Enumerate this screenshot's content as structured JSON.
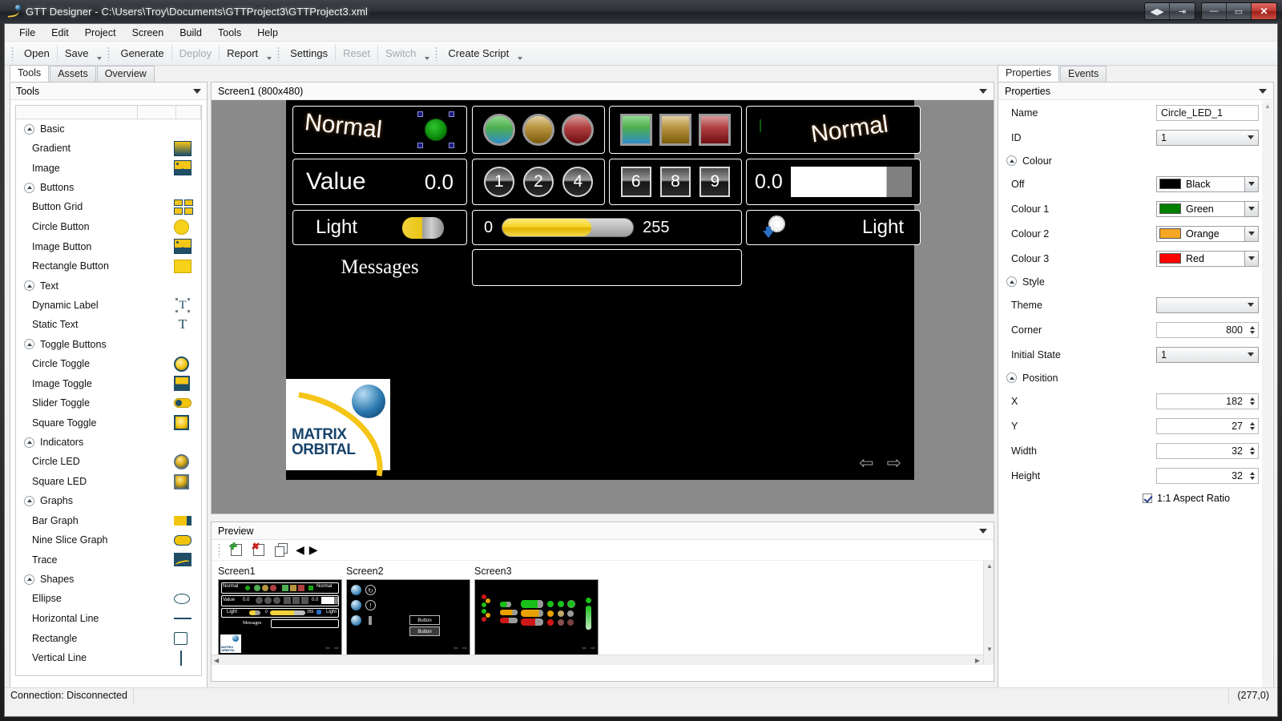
{
  "window": {
    "title": "GTT Designer - C:\\Users\\Troy\\Documents\\GTTProject3\\GTTProject3.xml",
    "buttons": {
      "split": "◀▶",
      "logout": "⇥",
      "minimize": "—",
      "maximize": "▭",
      "close": "✕"
    }
  },
  "menu": [
    "File",
    "Edit",
    "Project",
    "Screen",
    "Build",
    "Tools",
    "Help"
  ],
  "toolbar": {
    "groups": [
      {
        "items": [
          {
            "label": "Open",
            "enabled": true
          },
          {
            "label": "Save",
            "enabled": true
          }
        ]
      },
      {
        "items": [
          {
            "label": "Generate",
            "enabled": true
          },
          {
            "label": "Deploy",
            "enabled": false
          },
          {
            "label": "Report",
            "enabled": true
          }
        ]
      },
      {
        "items": [
          {
            "label": "Settings",
            "enabled": true
          },
          {
            "label": "Reset",
            "enabled": false
          },
          {
            "label": "Switch",
            "enabled": false
          }
        ]
      },
      {
        "items": [
          {
            "label": "Create Script",
            "enabled": true
          }
        ]
      }
    ]
  },
  "left_panel": {
    "tabs": [
      {
        "label": "Tools",
        "active": true
      },
      {
        "label": "Assets",
        "active": false
      },
      {
        "label": "Overview",
        "active": false
      }
    ],
    "header": "Tools",
    "groups": [
      {
        "name": "Basic",
        "items": [
          {
            "label": "Gradient",
            "icon": "gradient-icon"
          },
          {
            "label": "Image",
            "icon": "image-icon"
          }
        ]
      },
      {
        "name": "Buttons",
        "items": [
          {
            "label": "Button Grid",
            "icon": "button-grid-icon"
          },
          {
            "label": "Circle Button",
            "icon": "circle-button-icon"
          },
          {
            "label": "Image Button",
            "icon": "image-button-icon"
          },
          {
            "label": "Rectangle Button",
            "icon": "rectangle-button-icon"
          }
        ]
      },
      {
        "name": "Text",
        "items": [
          {
            "label": "Dynamic Label",
            "icon": "dynamic-label-icon"
          },
          {
            "label": "Static Text",
            "icon": "static-text-icon"
          }
        ]
      },
      {
        "name": "Toggle Buttons",
        "items": [
          {
            "label": "Circle Toggle",
            "icon": "circle-toggle-icon"
          },
          {
            "label": "Image Toggle",
            "icon": "image-toggle-icon"
          },
          {
            "label": "Slider Toggle",
            "icon": "slider-toggle-icon"
          },
          {
            "label": "Square Toggle",
            "icon": "square-toggle-icon"
          }
        ]
      },
      {
        "name": "Indicators",
        "items": [
          {
            "label": "Circle LED",
            "icon": "circle-led-icon"
          },
          {
            "label": "Square LED",
            "icon": "square-led-icon"
          }
        ]
      },
      {
        "name": "Graphs",
        "items": [
          {
            "label": "Bar Graph",
            "icon": "bar-graph-icon"
          },
          {
            "label": "Nine Slice Graph",
            "icon": "nine-slice-graph-icon"
          },
          {
            "label": "Trace",
            "icon": "trace-icon"
          }
        ]
      },
      {
        "name": "Shapes",
        "items": [
          {
            "label": "Ellipse",
            "icon": "ellipse-icon"
          },
          {
            "label": "Horizontal Line",
            "icon": "horizontal-line-icon"
          },
          {
            "label": "Rectangle",
            "icon": "rectangle-icon"
          },
          {
            "label": "Vertical Line",
            "icon": "vertical-line-icon"
          }
        ]
      }
    ]
  },
  "canvas": {
    "header": "Screen1 (800x480)",
    "widgets": {
      "normal_left_text": "Normal",
      "normal_right_text": "Normal",
      "value_label": "Value",
      "value_number": "0.0",
      "bar_value": "0.0",
      "light_left_label": "Light",
      "light_right_label": "Light",
      "slider_min": "0",
      "slider_max": "255",
      "slider_percent": 68,
      "messages_label": "Messages",
      "circle_numbers": [
        "1",
        "2",
        "4"
      ],
      "square_numbers": [
        "6",
        "8",
        "9"
      ],
      "logo_line1": "MATRIX",
      "logo_line2": "ORBITAL",
      "nav_prev": "⇦",
      "nav_next": "⇨"
    }
  },
  "preview": {
    "header": "Preview",
    "tools": [
      "add-screen-icon",
      "delete-screen-icon",
      "copy-screen-icon",
      "prev-screen-icon",
      "next-screen-icon"
    ],
    "screens": [
      {
        "name": "Screen1"
      },
      {
        "name": "Screen2"
      },
      {
        "name": "Screen3"
      }
    ]
  },
  "properties": {
    "tabs": [
      {
        "label": "Properties",
        "active": true
      },
      {
        "label": "Events",
        "active": false
      }
    ],
    "header": "Properties",
    "fields": {
      "name_label": "Name",
      "name_value": "Circle_LED_1",
      "id_label": "ID",
      "id_value": "1",
      "colour_group": "Colour",
      "off_label": "Off",
      "off_value": "Black",
      "off_hex": "#000000",
      "colour1_label": "Colour 1",
      "colour1_value": "Green",
      "colour1_hex": "#008000",
      "colour2_label": "Colour 2",
      "colour2_value": "Orange",
      "colour2_hex": "#F5A623",
      "colour3_label": "Colour 3",
      "colour3_value": "Red",
      "colour3_hex": "#FF0000",
      "style_group": "Style",
      "theme_label": "Theme",
      "theme_value": "",
      "corner_label": "Corner",
      "corner_value": "800",
      "initial_state_label": "Initial State",
      "initial_state_value": "1",
      "position_group": "Position",
      "x_label": "X",
      "x_value": "182",
      "y_label": "Y",
      "y_value": "27",
      "width_label": "Width",
      "width_value": "32",
      "height_label": "Height",
      "height_value": "32",
      "aspect_label": "1:1 Aspect Ratio"
    }
  },
  "statusbar": {
    "connection": "Connection: Disconnected",
    "coordinates": "(277,0)"
  }
}
